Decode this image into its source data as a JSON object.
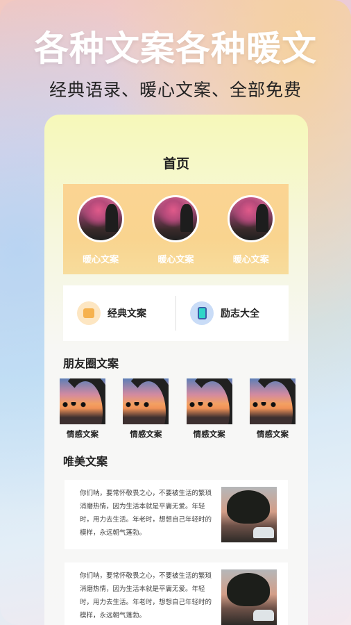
{
  "promo": {
    "headline": "各种文案各种暖文",
    "subline": "经典语录、暖心文案、全部免费"
  },
  "app": {
    "page_title": "首页",
    "banner": {
      "items": [
        {
          "label": "暖心文案"
        },
        {
          "label": "暖心文案"
        },
        {
          "label": "暖心文案"
        }
      ]
    },
    "menu": [
      {
        "label": "经典文案",
        "icon": "book-icon"
      },
      {
        "label": "励志大全",
        "icon": "tablet-icon"
      }
    ],
    "moments": {
      "title": "朋友圈文案",
      "items": [
        {
          "label": "情感文案"
        },
        {
          "label": "情感文案"
        },
        {
          "label": "情感文案"
        },
        {
          "label": "情感文案"
        }
      ]
    },
    "beautiful": {
      "title": "唯美文案",
      "articles": [
        {
          "text": "你们呐，要常怀敬畏之心，不要被生活的繁琐消磨热情，因为生活本就是平庸无爱。年轻时，用力去生活。年老时，想想自己年轻时的模样，永远朝气蓬勃。"
        },
        {
          "text": "你们呐，要常怀敬畏之心，不要被生活的繁琐消磨热情，因为生活本就是平庸无爱。年轻时，用力去生活。年老时，想想自己年轻时的模样，永远朝气蓬勃。"
        }
      ]
    }
  },
  "colors": {
    "banner": "#fbd493",
    "card": "#ffffff",
    "text": "#222222"
  }
}
